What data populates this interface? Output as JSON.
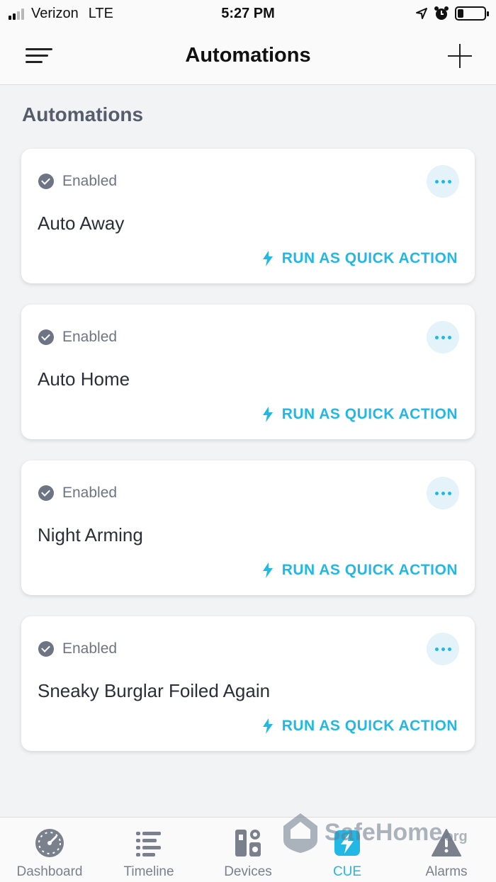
{
  "status_bar": {
    "carrier": "Verizon",
    "network": "LTE",
    "time": "5:27 PM"
  },
  "header": {
    "title": "Automations"
  },
  "section": {
    "title": "Automations"
  },
  "automations": [
    {
      "status": "Enabled",
      "name": "Auto Away",
      "action_label": "RUN AS QUICK ACTION"
    },
    {
      "status": "Enabled",
      "name": "Auto Home",
      "action_label": "RUN AS QUICK ACTION"
    },
    {
      "status": "Enabled",
      "name": "Night Arming",
      "action_label": "RUN AS QUICK ACTION"
    },
    {
      "status": "Enabled",
      "name": "Sneaky Burglar Foiled Again",
      "action_label": "RUN AS QUICK ACTION"
    }
  ],
  "tabs": [
    {
      "label": "Dashboard",
      "icon": "dashboard-icon"
    },
    {
      "label": "Timeline",
      "icon": "timeline-icon"
    },
    {
      "label": "Devices",
      "icon": "devices-icon"
    },
    {
      "label": "CUE",
      "icon": "cue-icon",
      "active": true
    },
    {
      "label": "Alarms",
      "icon": "alarms-icon"
    }
  ],
  "watermark": {
    "text": "SafeHome",
    "suffix": ".org"
  },
  "colors": {
    "accent": "#22b8e6",
    "muted": "#6d7483",
    "background": "#f2f3f5"
  }
}
